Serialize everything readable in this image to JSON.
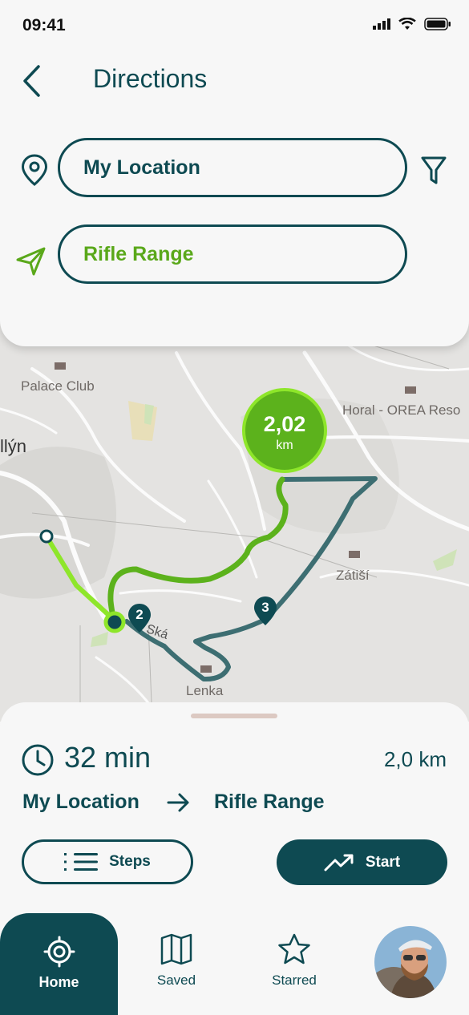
{
  "status_bar": {
    "time": "09:41"
  },
  "header": {
    "title": "Directions"
  },
  "search": {
    "origin_value": "My Location",
    "destination_value": "Rifle Range"
  },
  "map": {
    "distance_bubble": {
      "value": "2,02",
      "unit": "km"
    },
    "labels": {
      "palace_club": "Palace Club",
      "horal": "Horal - OREA Reso",
      "lyn": "llýn",
      "zatisi": "Zátiší",
      "lenka": "Lenka",
      "street": "Ská"
    },
    "markers": [
      "2",
      "3"
    ],
    "colors": {
      "route_done": "#5cb21c",
      "route_alt": "#3d6e72",
      "route_start": "#8ee62a"
    }
  },
  "summary": {
    "duration": "32 min",
    "distance": "2,0 km",
    "from": "My Location",
    "to": "Rifle Range",
    "steps_label": "Steps",
    "start_label": "Start"
  },
  "nav": {
    "items": [
      {
        "label": "Home",
        "icon": "target-icon"
      },
      {
        "label": "Saved",
        "icon": "map-icon"
      },
      {
        "label": "Starred",
        "icon": "star-icon"
      }
    ]
  },
  "colors": {
    "primary": "#0e4a52",
    "accent": "#5aa81a",
    "background": "#f6f6f6"
  }
}
